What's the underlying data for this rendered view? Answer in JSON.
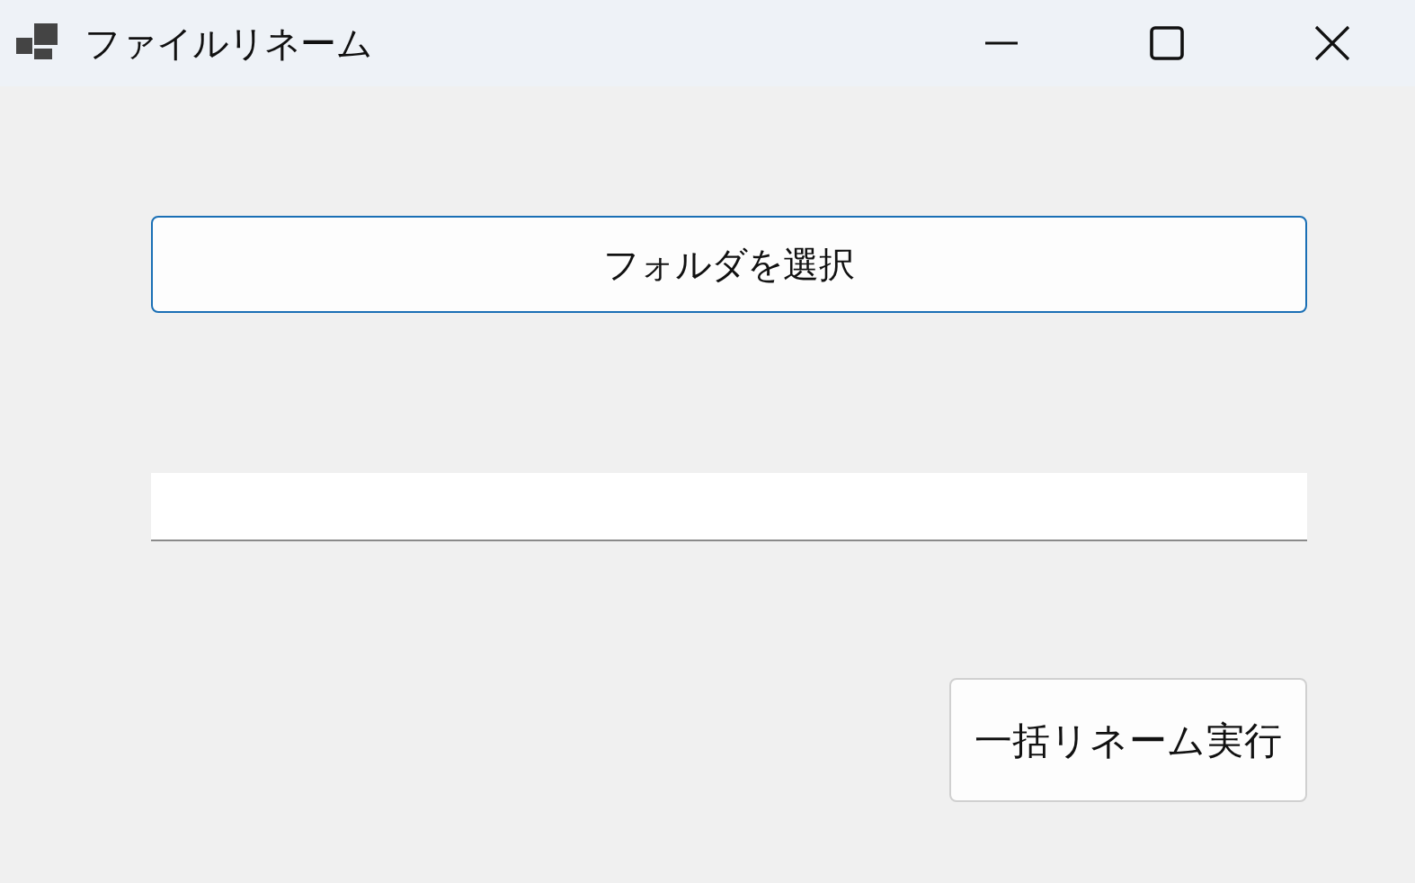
{
  "window": {
    "title": "ファイルリネーム"
  },
  "select_folder_button": {
    "label": "フォルダを選択",
    "focused": true
  },
  "rename_button": {
    "label": "一括リネーム実行"
  }
}
